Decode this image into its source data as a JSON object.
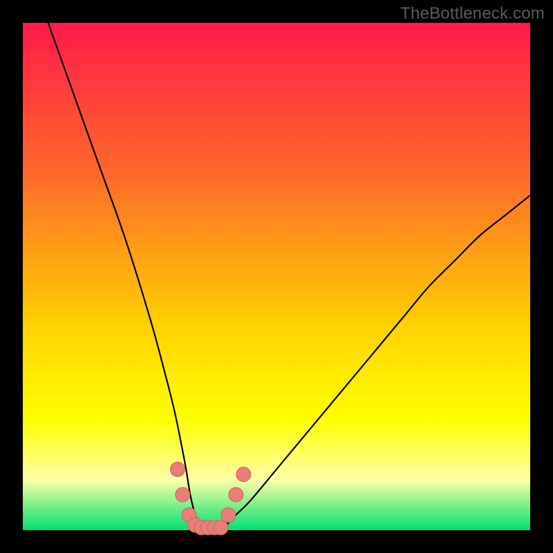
{
  "watermark": "TheBottleneck.com",
  "colors": {
    "black": "#000000",
    "curve": "#000000",
    "marker_fill": "#e77f76",
    "marker_stroke": "#cf6259",
    "grad_top": "#ff1a4a",
    "grad_mid_upper": "#ff6a2a",
    "grad_mid": "#ffd200",
    "grad_yellow": "#ffff00",
    "grad_cream": "#ffffa8",
    "grad_green": "#00e070"
  },
  "chart_data": {
    "type": "line",
    "title": "",
    "xlabel": "",
    "ylabel": "",
    "x_range": [
      0,
      100
    ],
    "y_range": [
      0,
      100
    ],
    "series": [
      {
        "name": "bottleneck-curve",
        "x": [
          5,
          10,
          15,
          20,
          25,
          28,
          30,
          32,
          33,
          34,
          35,
          36,
          37,
          38,
          40,
          42,
          45,
          50,
          55,
          60,
          65,
          70,
          75,
          80,
          85,
          90,
          95,
          100
        ],
        "values": [
          100,
          86,
          72,
          58,
          42,
          31,
          23,
          13,
          7,
          3,
          1,
          0,
          0,
          0,
          1,
          3,
          6,
          12,
          18,
          24,
          30,
          36,
          42,
          48,
          53,
          58,
          62,
          66
        ]
      }
    ],
    "markers": {
      "name": "highlighted-points",
      "x": [
        30.5,
        31.5,
        32.8,
        34.0,
        35.2,
        36.5,
        37.8,
        39.0,
        40.5,
        42.0,
        43.5
      ],
      "values": [
        12.0,
        7.0,
        3.0,
        1.0,
        0.5,
        0.5,
        0.5,
        0.5,
        3.0,
        7.0,
        11.0
      ]
    },
    "gradient_stops": [
      {
        "offset": 0.0,
        "key": "grad_top"
      },
      {
        "offset": 0.3,
        "key": "grad_mid_upper"
      },
      {
        "offset": 0.6,
        "key": "grad_mid"
      },
      {
        "offset": 0.78,
        "key": "grad_yellow"
      },
      {
        "offset": 0.9,
        "key": "grad_cream"
      },
      {
        "offset": 1.0,
        "key": "grad_green"
      }
    ]
  }
}
